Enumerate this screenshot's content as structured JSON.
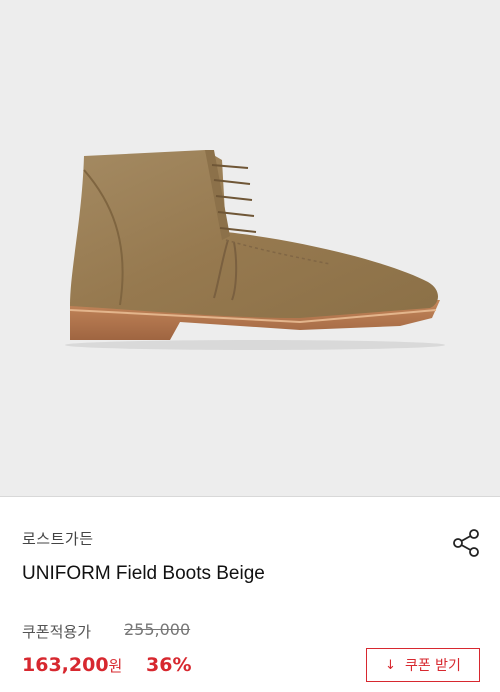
{
  "product": {
    "image_alt": "UNIFORM Field Boots Beige",
    "brand": "로스트가든",
    "title": "UNIFORM Field Boots Beige"
  },
  "pricing": {
    "coupon_label": "쿠폰적용가",
    "original_price": "255,000",
    "sale_price": "163,200",
    "currency": "원",
    "discount": "36%"
  },
  "actions": {
    "coupon_button_label": "쿠폰 받기",
    "download_icon": "download-icon",
    "share_icon": "share-icon"
  },
  "colors": {
    "accent": "#d7282f",
    "image_background": "#ededed",
    "boot_suede": "#9a8058",
    "sole": "#b0774f"
  }
}
